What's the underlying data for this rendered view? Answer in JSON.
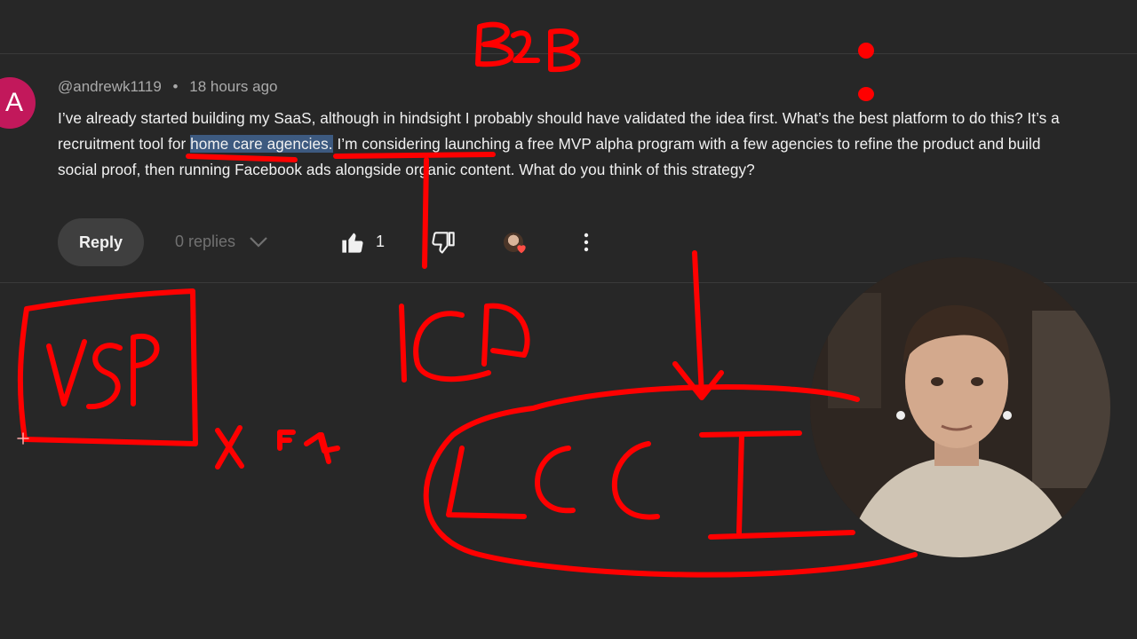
{
  "comment": {
    "avatar_letter": "A",
    "author": "@andrewk1119",
    "separator": "•",
    "time": "18 hours ago",
    "text_part1": "I’ve already started building my SaaS, although in hindsight I probably should have validated the idea first. What’s the best platform to do this?   It’s a recruitment tool for ",
    "text_highlight": "home care agencies.",
    "text_part2": " I’m considering launching a free MVP alpha program with a few agencies to refine the product and build social proof, then running Facebook ads alongside organic content.  What do you think of this strategy?"
  },
  "actions": {
    "reply_label": "Reply",
    "replies_label": "0 replies",
    "like_count": "1"
  },
  "annotations": {
    "color": "#ff0000",
    "labels": [
      "B2B",
      "VSP",
      "ICP",
      "LCCI"
    ]
  },
  "colors": {
    "background": "#272727",
    "avatar": "#c2185b",
    "highlight": "#3d5a80",
    "heart": "#ff4e45"
  },
  "icons": [
    "like-icon",
    "dislike-icon",
    "creator-heart-icon",
    "more-vert-icon",
    "chevron-down-icon"
  ]
}
